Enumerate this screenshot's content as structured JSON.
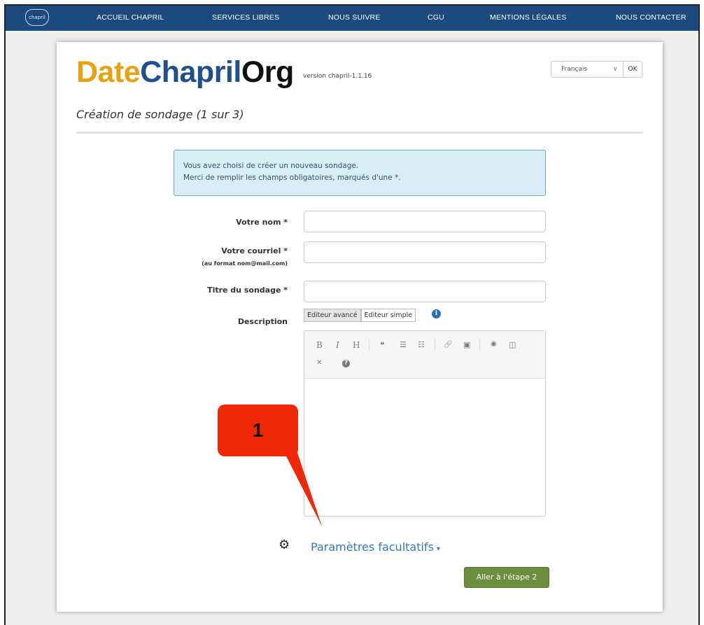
{
  "nav": {
    "logo_text": "chapril",
    "items": [
      "ACCUEIL CHAPRIL",
      "SERVICES LIBRES",
      "NOUS SUIVRE",
      "CGU",
      "MENTIONS LÉGALES",
      "NOUS CONTACTER"
    ]
  },
  "brand": {
    "part1": "Date",
    "part2": "Chapril",
    "part3": "Org",
    "version": "version chapril-1.1.16"
  },
  "language": {
    "selected": "Français",
    "ok_label": "OK"
  },
  "page": {
    "subtitle": "Création de sondage (1 sur 3)"
  },
  "alert": {
    "line1": "Vous avez choisi de créer un nouveau sondage.",
    "line2": "Merci de remplir les champs obligatoires, marqués d'une *."
  },
  "form": {
    "name_label": "Votre nom *",
    "email_label": "Votre courriel *",
    "email_hint": "(au format nom@mail.com)",
    "title_label": "Titre du sondage *",
    "description_label": "Description",
    "tab_advanced": "Editeur avancé",
    "tab_simple": "Editeur simple",
    "info_icon_text": "i"
  },
  "toolbar": {
    "bold": "B",
    "italic": "I",
    "heading": "H",
    "quote": "❝",
    "ul": "☰",
    "ol": "☷",
    "link": "🔗",
    "image": "▣",
    "preview": "◉",
    "side": "◫",
    "fullscreen": "✕",
    "help": "?"
  },
  "annotation": {
    "callout_number": "1"
  },
  "options": {
    "params_label": "Paramètres facultatifs",
    "caret": "▾"
  },
  "actions": {
    "next_label": "Aller à l'étape 2"
  },
  "colors": {
    "nav_bg": "#1d4a7e",
    "brand_orange": "#e8a10f",
    "brand_blue": "#214f8e",
    "next_btn": "#6b8e3e",
    "callout": "#f02805"
  }
}
